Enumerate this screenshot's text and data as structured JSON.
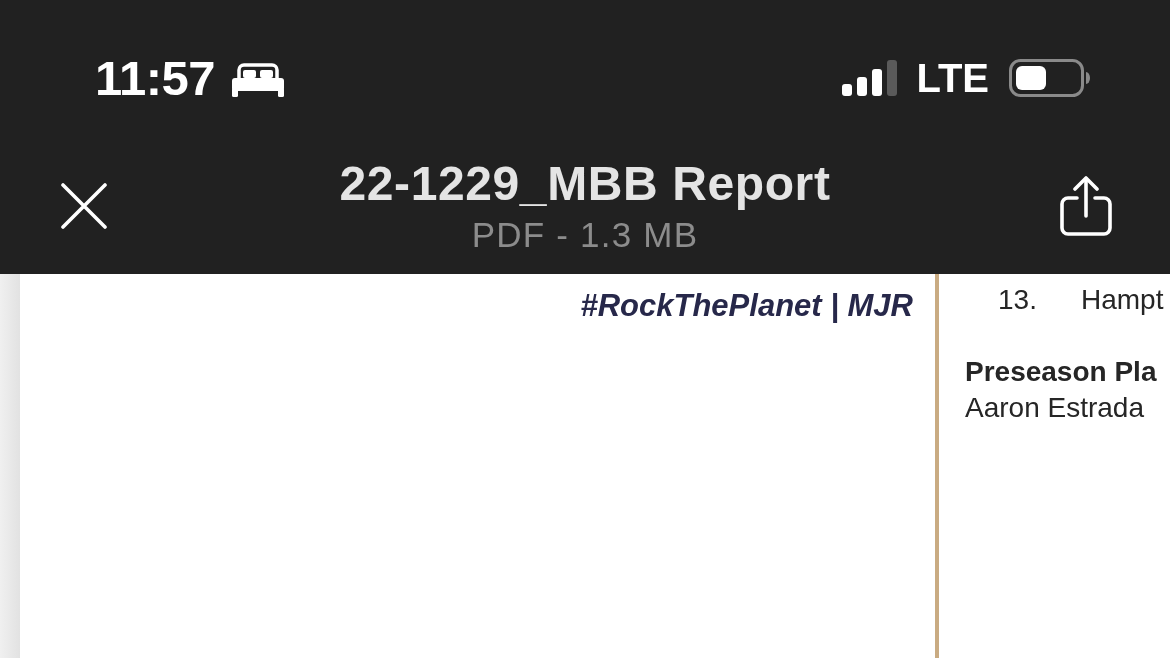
{
  "status_bar": {
    "time": "11:57",
    "network": "LTE"
  },
  "header": {
    "title": "22-1229_MBB Report",
    "subtitle": "PDF - 1.3 MB"
  },
  "document": {
    "left_page": {
      "tagline": "#RockThePlanet | MJR"
    },
    "right_page": {
      "list": [
        {
          "number": "13.",
          "text": "Hampt"
        }
      ],
      "heading": "Preseason Pla",
      "body": "Aaron Estrada"
    }
  }
}
